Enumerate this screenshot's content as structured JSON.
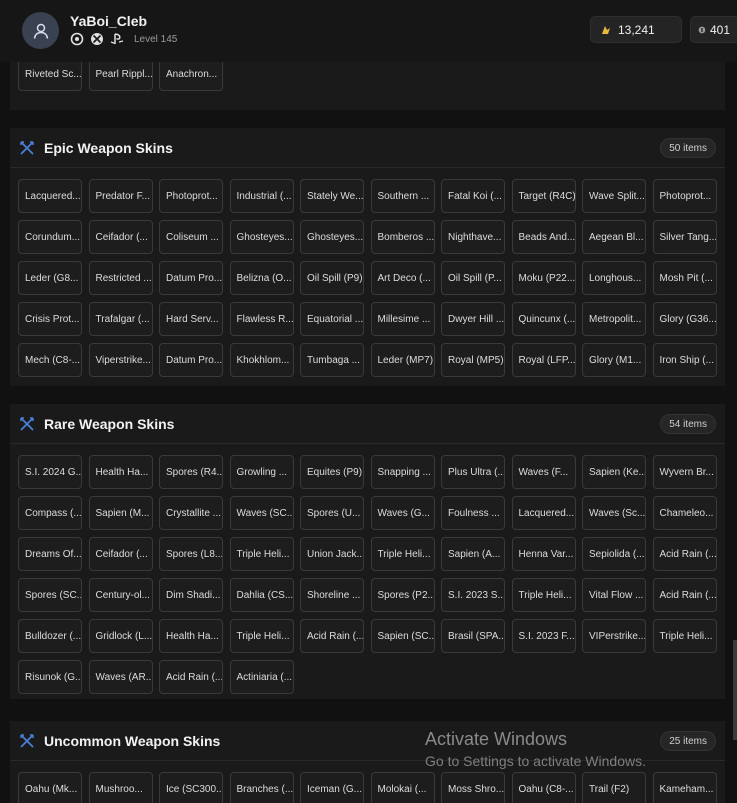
{
  "profile": {
    "username": "YaBoi_Cleb",
    "level": "Level 145",
    "platforms": [
      "ubisoft-icon",
      "xbox-icon",
      "playstation-icon"
    ]
  },
  "currency": {
    "credits": "13,241",
    "tokens": "401"
  },
  "top_section": {
    "items": [
      "Riveted Sc...",
      "Pearl Rippl...",
      "Anachron..."
    ]
  },
  "epic": {
    "title": "Epic Weapon Skins",
    "count": "50 items",
    "items": [
      "Lacquered...",
      "Predator F...",
      "Photoprot...",
      "Industrial (...",
      "Stately We...",
      "Southern ...",
      "Fatal Koi (...",
      "Target (R4C)",
      "Wave Split...",
      "Photoprot...",
      "Corundum...",
      "Ceifador (...",
      "Coliseum ...",
      "Ghosteyes...",
      "Ghosteyes...",
      "Bomberos ...",
      "Nighthave...",
      "Beads And...",
      "Aegean Bl...",
      "Silver Tang...",
      "Leder (G8...",
      "Restricted ...",
      "Datum Pro...",
      "Belizna (O...",
      "Oil Spill (P9)",
      "Art Deco (...",
      "Oil Spill (P...",
      "Moku (P22...",
      "Longhous...",
      "Mosh Pit (...",
      "Crisis Prot...",
      "Trafalgar (...",
      "Hard Serv...",
      "Flawless R...",
      "Equatorial ...",
      "Millesime ...",
      "Dwyer Hill ...",
      "Quincunx (...",
      "Metropolit...",
      "Glory (G36...",
      "Mech (C8-...",
      "Viperstrike...",
      "Datum Pro...",
      "Khokhlom...",
      "Tumbaga ...",
      "Leder (MP7)",
      "Royal (MP5)",
      "Royal (LFP...",
      "Glory (M1...",
      "Iron Ship (..."
    ]
  },
  "rare": {
    "title": "Rare Weapon Skins",
    "count": "54 items",
    "items": [
      "S.I. 2024 G...",
      "Health Ha...",
      "Spores (R4...",
      "Growling ...",
      "Equites (P9)",
      "Snapping ...",
      "Plus Ultra (...",
      "Waves (F...",
      "Sapien (Ke...",
      "Wyvern Br...",
      "Compass (...",
      "Sapien (M...",
      "Crystallite ...",
      "Waves (SC...",
      "Spores (U...",
      "Waves (G...",
      "Foulness ...",
      "Lacquered...",
      "Waves (Sc...",
      "Chameleo...",
      "Dreams Of...",
      "Ceifador (...",
      "Spores (L8...",
      "Triple Heli...",
      "Union Jack...",
      "Triple Heli...",
      "Sapien (A...",
      "Henna Var...",
      "Sepiolida (...",
      "Acid Rain (...",
      "Spores (SC...",
      "Century-ol...",
      "Dim Shadi...",
      "Dahlia (CS...",
      "Shoreline ...",
      "Spores (P2...",
      "S.I. 2023 S...",
      "Triple Heli...",
      "Vital Flow ...",
      "Acid Rain (...",
      "Bulldozer (...",
      "Gridlock (L...",
      "Health Ha...",
      "Triple Heli...",
      "Acid Rain (...",
      "Sapien (SC...",
      "Brasil (SPA...",
      "S.I. 2023 F...",
      "VIPerstrike...",
      "Triple Heli...",
      "Risunok (G...",
      "Waves (AR...",
      "Acid Rain (...",
      "Actiniaria (..."
    ]
  },
  "uncommon": {
    "title": "Uncommon Weapon Skins",
    "count": "25 items",
    "items": [
      "Oahu (Mk...",
      "Mushroo...",
      "Ice (SC300...",
      "Branches (...",
      "Iceman (G...",
      "Molokai (...",
      "Moss Shro...",
      "Oahu (C8-...",
      "Trail (F2)",
      "Kameham..."
    ]
  },
  "watermark": {
    "line1": "Activate Windows",
    "line2": "Go to Settings to activate Windows."
  },
  "colors": {
    "accent_icon": "#4a7fd6",
    "credits_icon": "#e8b93c"
  }
}
